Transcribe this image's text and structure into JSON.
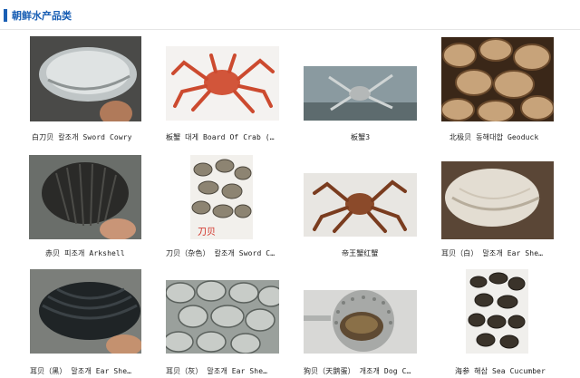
{
  "header": {
    "title": "朝鲜水产品类",
    "accent": "#1a5fb4"
  },
  "products": [
    {
      "label": "白刀贝  칼조개 Sword Cowry",
      "icon": "clam-shell-image"
    },
    {
      "label": "板蟹 대게 Board Of Crab (…",
      "icon": "snow-crab-image"
    },
    {
      "label": "板蟹3",
      "icon": "crab-in-tank-image"
    },
    {
      "label": "北极贝 동해대합  Geoduck",
      "icon": "clams-pile-image"
    },
    {
      "label": "赤贝 피조개 Arkshell",
      "icon": "ark-shell-image"
    },
    {
      "label": "刀贝（杂色） 칼조개 Sword C…",
      "icon": "mixed-clams-image",
      "badge": "刀贝"
    },
    {
      "label": "帝王蟹红蟹",
      "icon": "king-crab-image"
    },
    {
      "label": "耳贝（白） 말조개  Ear She…",
      "icon": "white-ear-shell-image"
    },
    {
      "label": "耳贝（黑） 말조개  Ear She…",
      "icon": "black-ear-shell-image"
    },
    {
      "label": "耳贝（灰） 말조개  Ear She…",
      "icon": "grey-clams-image"
    },
    {
      "label": "狗贝（天鹅蛋） 개조개 Dog C…",
      "icon": "dog-clam-image"
    },
    {
      "label": "海参 해삼 Sea Cucumber",
      "icon": "sea-cucumber-image"
    }
  ]
}
